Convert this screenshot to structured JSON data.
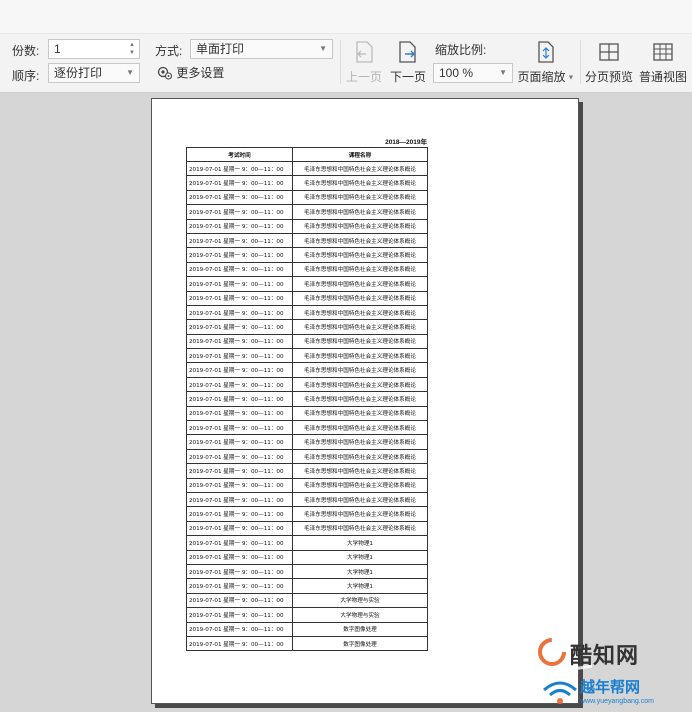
{
  "toolbar": {
    "copies_label": "份数:",
    "copies_value": "1",
    "order_label": "顺序:",
    "order_value": "逐份打印",
    "mode_label": "方式:",
    "mode_value": "单面打印",
    "more_settings": "更多设置",
    "prev_page": "上一页",
    "next_page": "下一页",
    "zoom_label": "缩放比例:",
    "zoom_value": "100 %",
    "page_zoom": "页面缩放",
    "page_break_preview": "分页预览",
    "normal_view": "普通视图"
  },
  "document": {
    "year_header": "2018—2019年",
    "columns": [
      "考试时间",
      "课程名称"
    ],
    "rows": [
      [
        "2019-07-01 星期一 9：00—11：00",
        "毛泽东思想和中国特色社会主义理论体系概论"
      ],
      [
        "2019-07-01 星期一 9：00—11：00",
        "毛泽东思想和中国特色社会主义理论体系概论"
      ],
      [
        "2019-07-01 星期一 9：00—11：00",
        "毛泽东思想和中国特色社会主义理论体系概论"
      ],
      [
        "2019-07-01 星期一 9：00—11：00",
        "毛泽东思想和中国特色社会主义理论体系概论"
      ],
      [
        "2019-07-01 星期一 9：00—11：00",
        "毛泽东思想和中国特色社会主义理论体系概论"
      ],
      [
        "2019-07-01 星期一 9：00—11：00",
        "毛泽东思想和中国特色社会主义理论体系概论"
      ],
      [
        "2019-07-01 星期一 9：00—11：00",
        "毛泽东思想和中国特色社会主义理论体系概论"
      ],
      [
        "2019-07-01 星期一 9：00—11：00",
        "毛泽东思想和中国特色社会主义理论体系概论"
      ],
      [
        "2019-07-01 星期一 9：00—11：00",
        "毛泽东思想和中国特色社会主义理论体系概论"
      ],
      [
        "2019-07-01 星期一 9：00—11：00",
        "毛泽东思想和中国特色社会主义理论体系概论"
      ],
      [
        "2019-07-01 星期一 9：00—11：00",
        "毛泽东思想和中国特色社会主义理论体系概论"
      ],
      [
        "2019-07-01 星期一 9：00—11：00",
        "毛泽东思想和中国特色社会主义理论体系概论"
      ],
      [
        "2019-07-01 星期一 9：00—11：00",
        "毛泽东思想和中国特色社会主义理论体系概论"
      ],
      [
        "2019-07-01 星期一 9：00—11：00",
        "毛泽东思想和中国特色社会主义理论体系概论"
      ],
      [
        "2019-07-01 星期一 9：00—11：00",
        "毛泽东思想和中国特色社会主义理论体系概论"
      ],
      [
        "2019-07-01 星期一 9：00—11：00",
        "毛泽东思想和中国特色社会主义理论体系概论"
      ],
      [
        "2019-07-01 星期一 9：00—11：00",
        "毛泽东思想和中国特色社会主义理论体系概论"
      ],
      [
        "2019-07-01 星期一 9：00—11：00",
        "毛泽东思想和中国特色社会主义理论体系概论"
      ],
      [
        "2019-07-01 星期一 9：00—11：00",
        "毛泽东思想和中国特色社会主义理论体系概论"
      ],
      [
        "2019-07-01 星期一 9：00—11：00",
        "毛泽东思想和中国特色社会主义理论体系概论"
      ],
      [
        "2019-07-01 星期一 9：00—11：00",
        "毛泽东思想和中国特色社会主义理论体系概论"
      ],
      [
        "2019-07-01 星期一 9：00—11：00",
        "毛泽东思想和中国特色社会主义理论体系概论"
      ],
      [
        "2019-07-01 星期一 9：00—11：00",
        "毛泽东思想和中国特色社会主义理论体系概论"
      ],
      [
        "2019-07-01 星期一 9：00—11：00",
        "毛泽东思想和中国特色社会主义理论体系概论"
      ],
      [
        "2019-07-01 星期一 9：00—11：00",
        "毛泽东思想和中国特色社会主义理论体系概论"
      ],
      [
        "2019-07-01 星期一 9：00—11：00",
        "毛泽东思想和中国特色社会主义理论体系概论"
      ],
      [
        "2019-07-01 星期一 9：00—11：00",
        "大学物理1"
      ],
      [
        "2019-07-01 星期一 9：00—11：00",
        "大学物理1"
      ],
      [
        "2019-07-01 星期一 9：00—11：00",
        "大学物理1"
      ],
      [
        "2019-07-01 星期一 9：00—11：00",
        "大学物理1"
      ],
      [
        "2019-07-01 星期一 9：00—11：00",
        "大学物理与实验"
      ],
      [
        "2019-07-01 星期一 9：00—11：00",
        "大学物理与实验"
      ],
      [
        "2019-07-01 星期一 9：00—11：00",
        "数字图像处理"
      ],
      [
        "2019-07-01 星期一 9：00—11：00",
        "数字图像处理"
      ]
    ]
  },
  "watermarks": {
    "brand1": "酷知网",
    "brand2": "越年帮网",
    "brand2_url": "www.yueyangbang.com"
  },
  "colors": {
    "toolbar_bg": "#f3f3f3",
    "workspace_bg": "#d6d6d6",
    "watermark_orange": "#e8743b",
    "watermark_blue": "#1a7fd0"
  }
}
